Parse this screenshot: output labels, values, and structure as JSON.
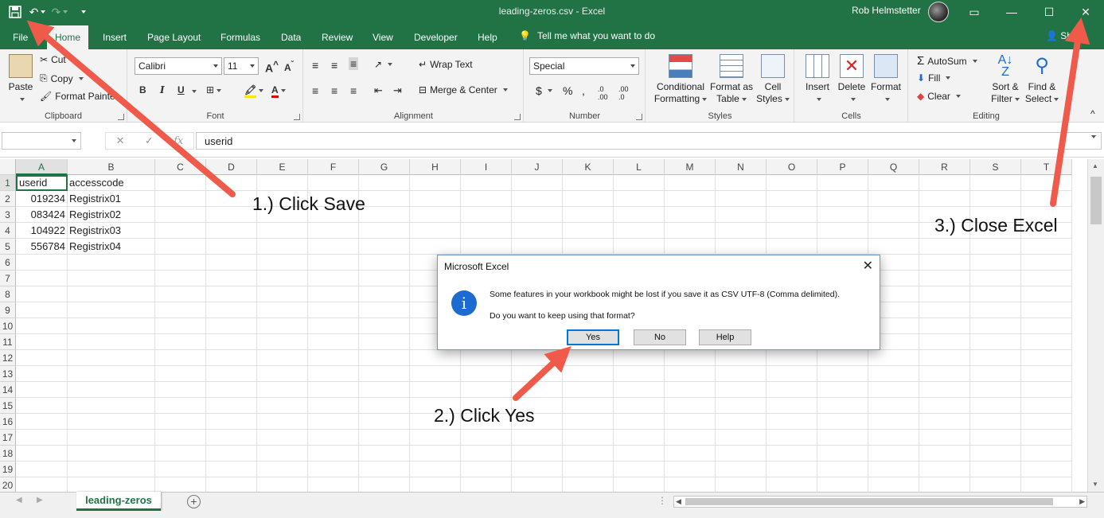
{
  "window": {
    "title": "leading-zeros.csv  -  Excel",
    "user": "Rob Helmstetter"
  },
  "tabs": [
    {
      "label": "File"
    },
    {
      "label": "Home"
    },
    {
      "label": "Insert"
    },
    {
      "label": "Page Layout"
    },
    {
      "label": "Formulas"
    },
    {
      "label": "Data"
    },
    {
      "label": "Review"
    },
    {
      "label": "View"
    },
    {
      "label": "Developer"
    },
    {
      "label": "Help"
    }
  ],
  "tell_me": "Tell me what you want to do",
  "share": "Sha",
  "ribbon": {
    "clipboard": {
      "label": "Clipboard",
      "paste": "Paste",
      "cut": "Cut",
      "copy": "Copy",
      "format_painter": "Format Painter"
    },
    "font": {
      "label": "Font",
      "font_name": "Calibri",
      "font_size": "11"
    },
    "alignment": {
      "label": "Alignment",
      "wrap_text": "Wrap Text",
      "merge_center": "Merge & Center"
    },
    "number": {
      "label": "Number",
      "format": "Special"
    },
    "styles": {
      "label": "Styles",
      "conditional": [
        "Conditional",
        "Formatting"
      ],
      "format_as_table": [
        "Format as",
        "Table"
      ],
      "cell_styles": [
        "Cell",
        "Styles"
      ]
    },
    "cells": {
      "label": "Cells",
      "insert": "Insert",
      "delete": "Delete",
      "format": "Format"
    },
    "editing": {
      "label": "Editing",
      "autosum": "AutoSum",
      "fill": "Fill",
      "clear": "Clear",
      "sort_filter": [
        "Sort &",
        "Filter"
      ],
      "find_select": [
        "Find &",
        "Select"
      ]
    }
  },
  "formula_bar": {
    "name_box": "",
    "content": "userid",
    "fx": "fx"
  },
  "columns": [
    "A",
    "B",
    "C",
    "D",
    "E",
    "F",
    "G",
    "H",
    "I",
    "J",
    "K",
    "L",
    "M",
    "N",
    "O",
    "P",
    "Q",
    "R",
    "S",
    "T"
  ],
  "rows": [
    "1",
    "2",
    "3",
    "4",
    "5",
    "6",
    "7",
    "8",
    "9",
    "10",
    "11",
    "12",
    "13",
    "14",
    "15",
    "16",
    "17",
    "18",
    "19",
    "20"
  ],
  "cells": [
    {
      "ref": "A1",
      "value": "userid"
    },
    {
      "ref": "B1",
      "value": "accesscode"
    },
    {
      "ref": "A2",
      "value": "019234"
    },
    {
      "ref": "B2",
      "value": "Registrix01"
    },
    {
      "ref": "A3",
      "value": "083424"
    },
    {
      "ref": "B3",
      "value": "Registrix02"
    },
    {
      "ref": "A4",
      "value": "104922"
    },
    {
      "ref": "B4",
      "value": "Registrix03"
    },
    {
      "ref": "A5",
      "value": "556784"
    },
    {
      "ref": "B5",
      "value": "Registrix04"
    }
  ],
  "sheet_tab": "leading-zeros",
  "dialog": {
    "title": "Microsoft Excel",
    "message": "Some features in your workbook might be lost if you save it as CSV UTF-8 (Comma delimited).",
    "question": "Do you want to keep using that format?",
    "buttons": {
      "yes": "Yes",
      "no": "No",
      "help": "Help"
    }
  },
  "annotations": {
    "step1": "1.) Click Save",
    "step2": "2.) Click Yes",
    "step3": "3.) Close Excel"
  },
  "colors": {
    "excel_green": "#217346",
    "arrow": "#f05a4a",
    "info_blue": "#1d6bd0"
  }
}
